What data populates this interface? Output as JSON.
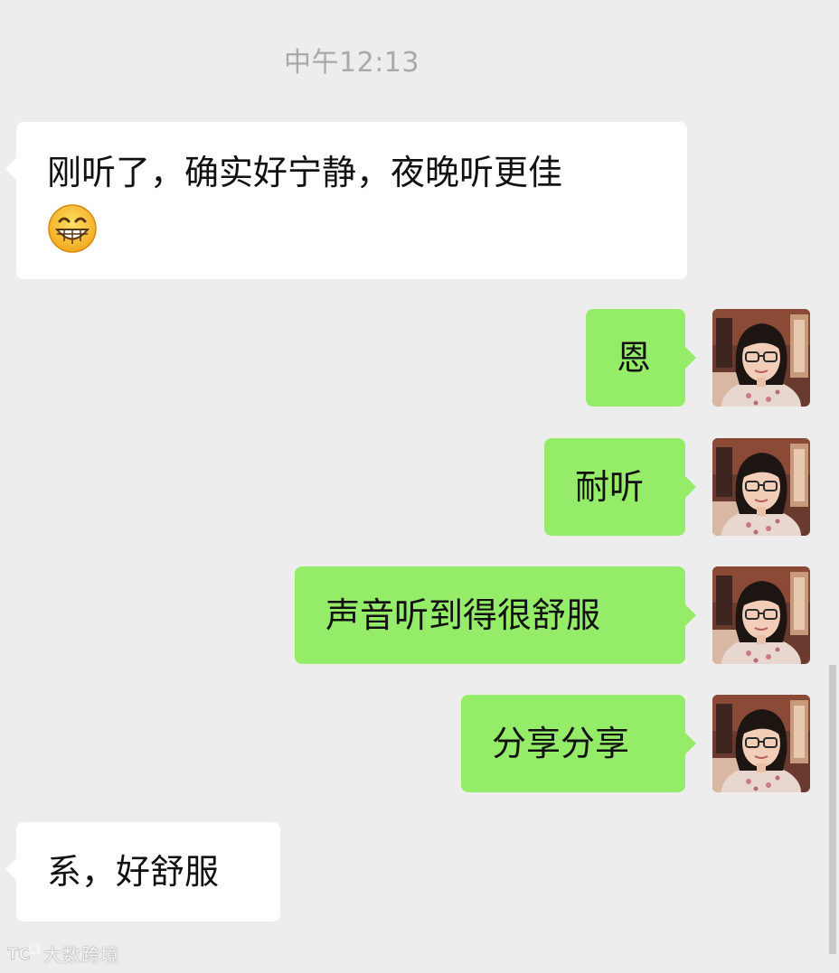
{
  "chat": {
    "timestamp": "中午12:13",
    "messages": [
      {
        "side": "incoming",
        "text": "刚听了，确实好宁静，夜晚听更佳",
        "emoji": "grinning-face-icon"
      },
      {
        "side": "outgoing",
        "text": "恩"
      },
      {
        "side": "outgoing",
        "text": "耐听"
      },
      {
        "side": "outgoing",
        "text": "声音听到得很舒服"
      },
      {
        "side": "outgoing",
        "text": "分享分享"
      },
      {
        "side": "incoming",
        "text": "系，好舒服"
      }
    ]
  },
  "watermark": {
    "logo": "TC",
    "text": "大数跨境"
  },
  "colors": {
    "background": "#ededed",
    "incoming_bubble": "#ffffff",
    "outgoing_bubble": "#95ec69",
    "timestamp": "#a9a9a9"
  }
}
